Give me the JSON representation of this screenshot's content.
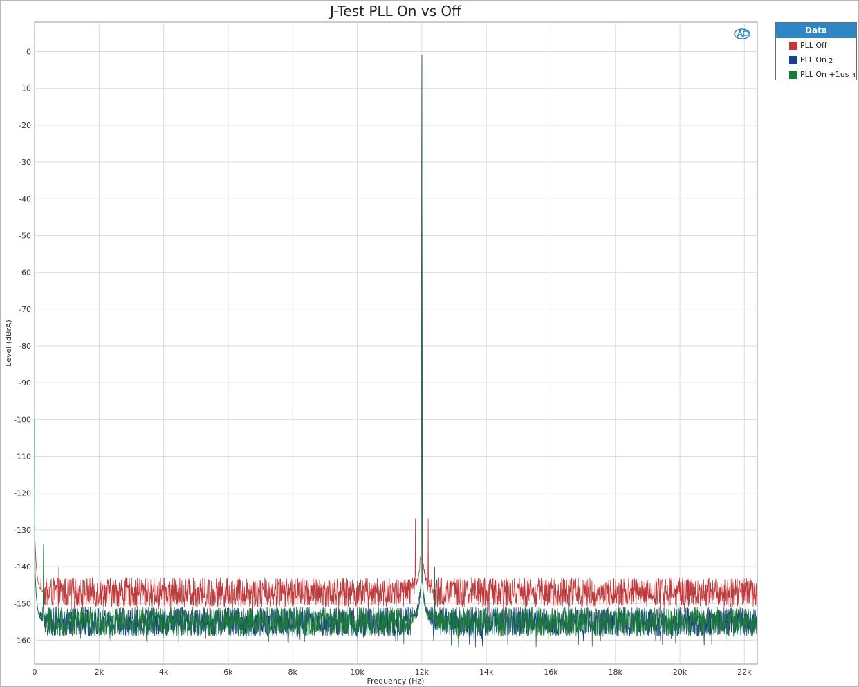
{
  "chart_data": {
    "type": "line",
    "title": "J-Test PLL On vs Off",
    "xlabel": "Frequency (Hz)",
    "ylabel": "Level (dBrA)",
    "xlim": [
      0,
      22400
    ],
    "ylim": [
      -166.5,
      8
    ],
    "x_ticks": [
      0,
      2000,
      4000,
      6000,
      8000,
      10000,
      12000,
      14000,
      16000,
      18000,
      20000,
      22000
    ],
    "x_tick_labels": [
      "0",
      "2k",
      "4k",
      "6k",
      "8k",
      "10k",
      "12k",
      "14k",
      "16k",
      "18k",
      "20k",
      "22k"
    ],
    "y_ticks": [
      0,
      -10,
      -20,
      -30,
      -40,
      -50,
      -60,
      -70,
      -80,
      -90,
      -100,
      -110,
      -120,
      -130,
      -140,
      -150,
      -160
    ],
    "y_tick_labels": [
      "0",
      "-10",
      "-20",
      "-30",
      "-40",
      "-50",
      "-60",
      "-70",
      "-80",
      "-90",
      "-100",
      "-110",
      "-120",
      "-130",
      "-140",
      "-150",
      "-160"
    ],
    "grid": true,
    "legend_placement": "outside-top-right",
    "legend_title": "Data",
    "series": [
      {
        "name": "PLL Off",
        "suffix": "",
        "color": "#c0393b",
        "noise_floor": -147,
        "noise_spread": 4,
        "peaks": [
          {
            "x": 0,
            "y": -136
          },
          {
            "x": 750,
            "y": -140
          },
          {
            "x": 11800,
            "y": -127
          },
          {
            "x": 12000,
            "y": -1
          },
          {
            "x": 12200,
            "y": -127
          }
        ]
      },
      {
        "name": "PLL On",
        "suffix": "2",
        "color": "#1d3f8f",
        "noise_floor": -155,
        "noise_spread": 4,
        "peaks": [
          {
            "x": 0,
            "y": -100
          },
          {
            "x": 280,
            "y": -134
          },
          {
            "x": 12000,
            "y": -1
          },
          {
            "x": 12400,
            "y": -140
          },
          {
            "x": 16550,
            "y": -150
          },
          {
            "x": 7500,
            "y": -150
          }
        ]
      },
      {
        "name": "PLL On +1us",
        "suffix": "3",
        "color": "#1a7a3a",
        "noise_floor": -155,
        "noise_spread": 4,
        "peaks": [
          {
            "x": 0,
            "y": -100
          },
          {
            "x": 280,
            "y": -134
          },
          {
            "x": 12000,
            "y": -1
          },
          {
            "x": 12400,
            "y": -141
          },
          {
            "x": 16550,
            "y": -151
          },
          {
            "x": 7500,
            "y": -150
          }
        ]
      }
    ]
  }
}
